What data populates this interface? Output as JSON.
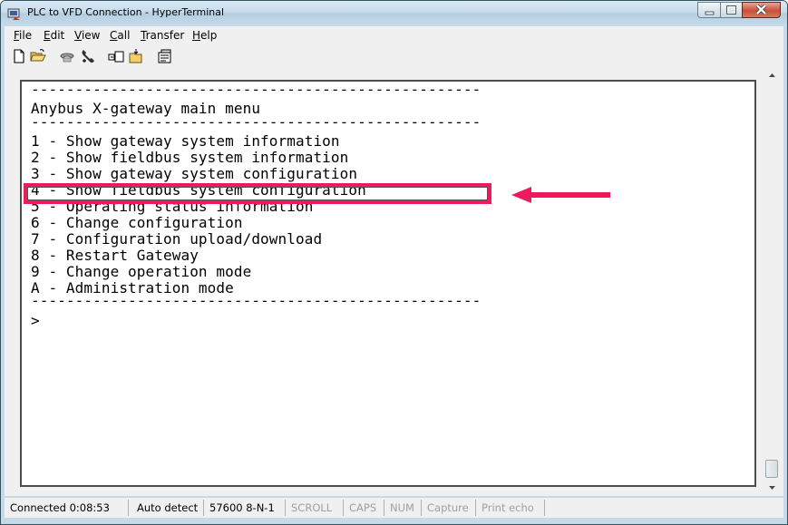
{
  "window": {
    "title": "PLC to VFD Connection - HyperTerminal",
    "icon": "hyperterminal-app-icon",
    "controls": [
      "minimize-icon",
      "maximize-icon",
      "close-icon"
    ]
  },
  "menubar": [
    {
      "label": "File",
      "accel": "F",
      "rest": "ile"
    },
    {
      "label": "Edit",
      "accel": "E",
      "rest": "dit"
    },
    {
      "label": "View",
      "accel": "V",
      "rest": "iew"
    },
    {
      "label": "Call",
      "accel": "C",
      "rest": "all"
    },
    {
      "label": "Transfer",
      "accel": "T",
      "rest": "ransfer"
    },
    {
      "label": "Help",
      "accel": "H",
      "rest": "elp"
    }
  ],
  "toolbar": [
    "new-file-icon",
    "open-folder-icon",
    "disconnect-phone-icon",
    "call-phone-icon",
    "send-file-icon",
    "receive-file-icon",
    "properties-icon"
  ],
  "terminal": {
    "separator": "---------------------------------------------------",
    "heading": "Anybus X-gateway main menu",
    "menu": [
      "1 - Show gateway system information",
      "2 - Show fieldbus system information",
      "3 - Show gateway system configuration",
      "4 - Show fieldbus system configuration",
      "5 - Operating status information",
      "6 - Change configuration",
      "7 - Configuration upload/download",
      "8 - Restart Gateway",
      "9 - Change operation mode",
      "A - Administration mode"
    ],
    "prompt": ">",
    "highlighted_index": 3,
    "highlight_color": "#f0195e"
  },
  "statusbar": {
    "connected": "Connected 0:08:53",
    "detect": "Auto detect",
    "settings": "57600 8-N-1",
    "scroll": "SCROLL",
    "caps": "CAPS",
    "num": "NUM",
    "capture": "Capture",
    "print_echo": "Print echo"
  }
}
